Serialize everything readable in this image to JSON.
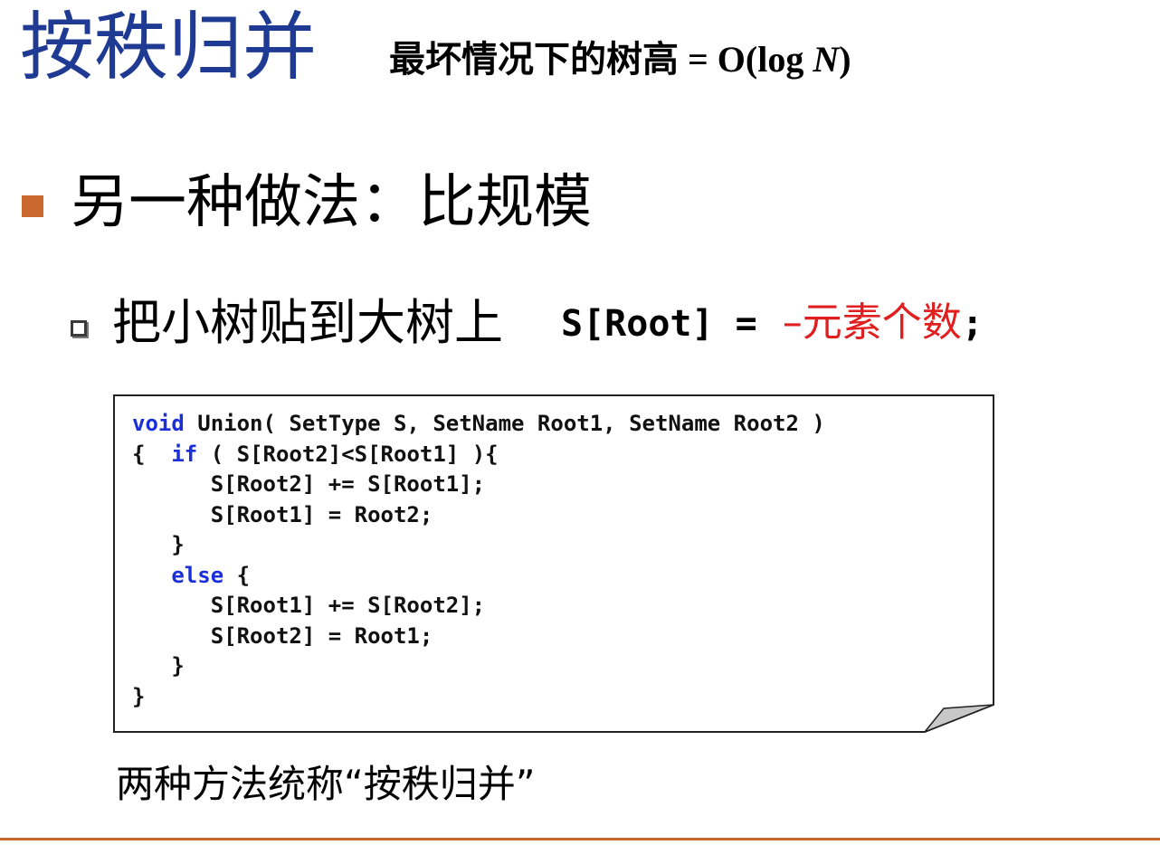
{
  "title": "按秩归并",
  "subtitle": {
    "prefix": "最坏情况下的树高 =  O(log ",
    "italic": "N",
    "suffix": ")"
  },
  "bullet": {
    "text": "另一种做法：比规模",
    "color": "#c8682c"
  },
  "sub_bullet": {
    "text": "把小树贴到大树上",
    "formula_left": "S[Root] =",
    "formula_red": "–元素个数",
    "formula_end": ";",
    "red_color": "#e02020"
  },
  "code": {
    "line1_kw": "void",
    "line1_rest": " Union( SetType S, SetName Root1, SetName Root2 )",
    "line2_pre": "{  ",
    "line2_kw": "if",
    "line2_rest": " ( S[Root2]<S[Root1] ){",
    "line3": "      S[Root2] += S[Root1];",
    "line4": "      S[Root1] = Root2;",
    "line5": "   }",
    "line6_pre": "   ",
    "line6_kw": "else",
    "line6_rest": " {",
    "line7": "      S[Root1] += S[Root2];",
    "line8": "      S[Root2] = Root1;",
    "line9": "   }",
    "line10": "}",
    "keyword_color": "#1a2fd8"
  },
  "summary": "两种方法统称“按秩归并”",
  "accent_color": "#c8682c",
  "title_color": "#1f3a93"
}
